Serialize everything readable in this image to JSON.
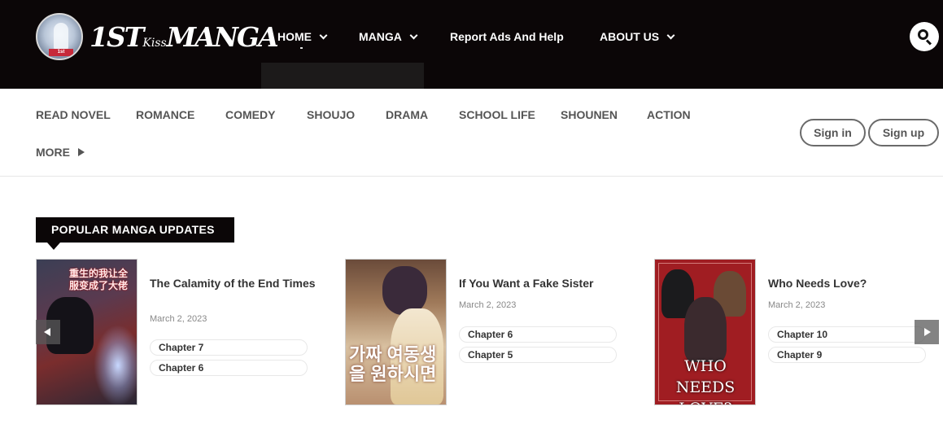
{
  "header": {
    "logo": {
      "text_main": "1ST",
      "text_small": "Kiss",
      "text_end": "MANGA",
      "badge_tag": "1st"
    },
    "nav": [
      {
        "label": "HOME",
        "has_dropdown": true
      },
      {
        "label": "MANGA",
        "has_dropdown": true
      },
      {
        "label": "Report Ads And Help",
        "has_dropdown": false
      },
      {
        "label": "ABOUT US",
        "has_dropdown": true
      }
    ],
    "search_icon": "search-icon"
  },
  "genres": {
    "items": [
      "READ NOVEL",
      "ROMANCE",
      "COMEDY",
      "SHOUJO",
      "DRAMA",
      "SCHOOL LIFE",
      "SHOUNEN",
      "ACTION"
    ],
    "more_label": "MORE"
  },
  "auth": {
    "sign_in": "Sign in",
    "sign_up": "Sign up"
  },
  "popular": {
    "title": "POPULAR MANGA UPDATES",
    "cards": [
      {
        "title": "The Calamity of the End Times",
        "date": "March 2, 2023",
        "cover_text": "重生的我让全服变成了大佬",
        "chapters": [
          "Chapter 7",
          "Chapter 6"
        ]
      },
      {
        "title": "If You Want a Fake Sister",
        "date": "March 2, 2023",
        "cover_text": "가짜 여동생을 원하시면",
        "chapters": [
          "Chapter 6",
          "Chapter 5"
        ]
      },
      {
        "title": "Who Needs Love?",
        "date": "March 2, 2023",
        "cover_text": "WHO NEEDS LOVE?",
        "chapters": [
          "Chapter 10",
          "Chapter 9"
        ]
      }
    ]
  },
  "colors": {
    "header_bg": "#0b0607",
    "text": "#333333",
    "muted": "#888888"
  }
}
